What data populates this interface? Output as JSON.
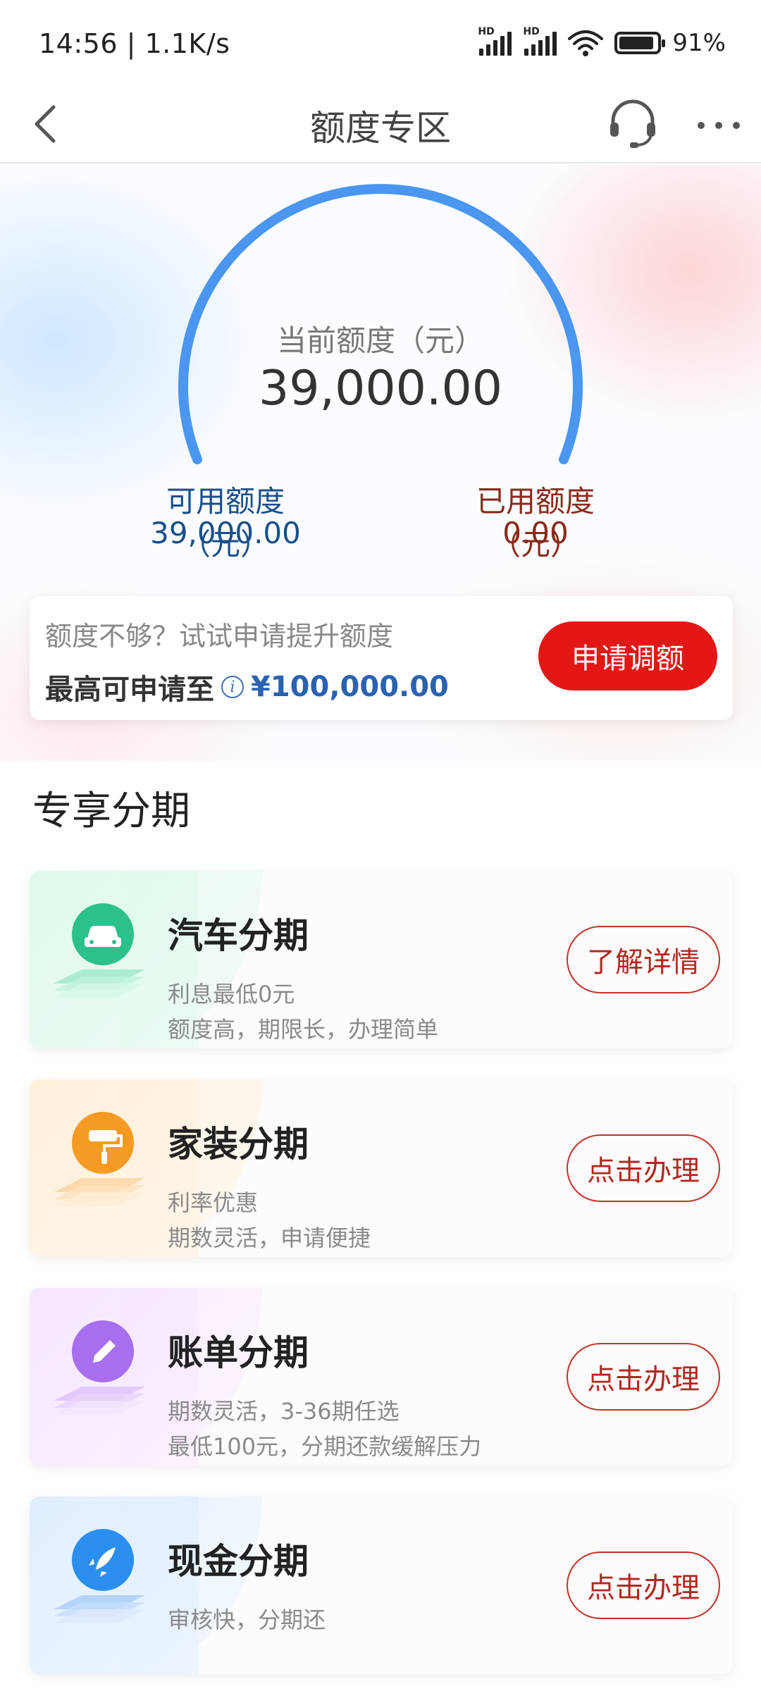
{
  "status_bar": {
    "time": "14:56 | 1.1K/s",
    "battery": "91%",
    "battery_level": 0.91,
    "signal_label": "HD"
  },
  "nav": {
    "title": "额度专区",
    "back_icon": "chevron-left-icon",
    "service_icon": "headset-icon",
    "more_icon": "more-dots-icon"
  },
  "quota": {
    "current_label": "当前额度（元）",
    "current_value": "39,000.00",
    "available_label": "可用额度（元）",
    "available_value": "39,000.00",
    "used_label": "已用额度（元）",
    "used_value": "0.00",
    "gauge_color": "#4a96f0"
  },
  "raise": {
    "hint": "额度不够？试试申请提升额度",
    "max_label": "最高可申请至",
    "max_value": "¥100,000.00",
    "button": "申请调额",
    "button_color": "#e41717"
  },
  "section": {
    "title": "专享分期"
  },
  "products": [
    {
      "title": "汽车分期",
      "desc1": "利息最低0元",
      "desc2": "额度高，期限长，办理简单",
      "button": "了解详情",
      "icon": "car-icon",
      "color": "#2cc18a"
    },
    {
      "title": "家装分期",
      "desc1": "利率优惠",
      "desc2": "期数灵活，申请便捷",
      "button": "点击办理",
      "icon": "paint-roller-icon",
      "color": "#f59a23"
    },
    {
      "title": "账单分期",
      "desc1": "期数灵活，3-36期任选",
      "desc2": "最低100元，分期还款缓解压力",
      "button": "点击办理",
      "icon": "pencil-icon",
      "color": "#a86ef0"
    },
    {
      "title": "现金分期",
      "desc1": "审核快，分期还",
      "desc2": "",
      "button": "点击办理",
      "icon": "rocket-icon",
      "color": "#2a8ff0"
    }
  ],
  "accent_red": "#b02a20"
}
